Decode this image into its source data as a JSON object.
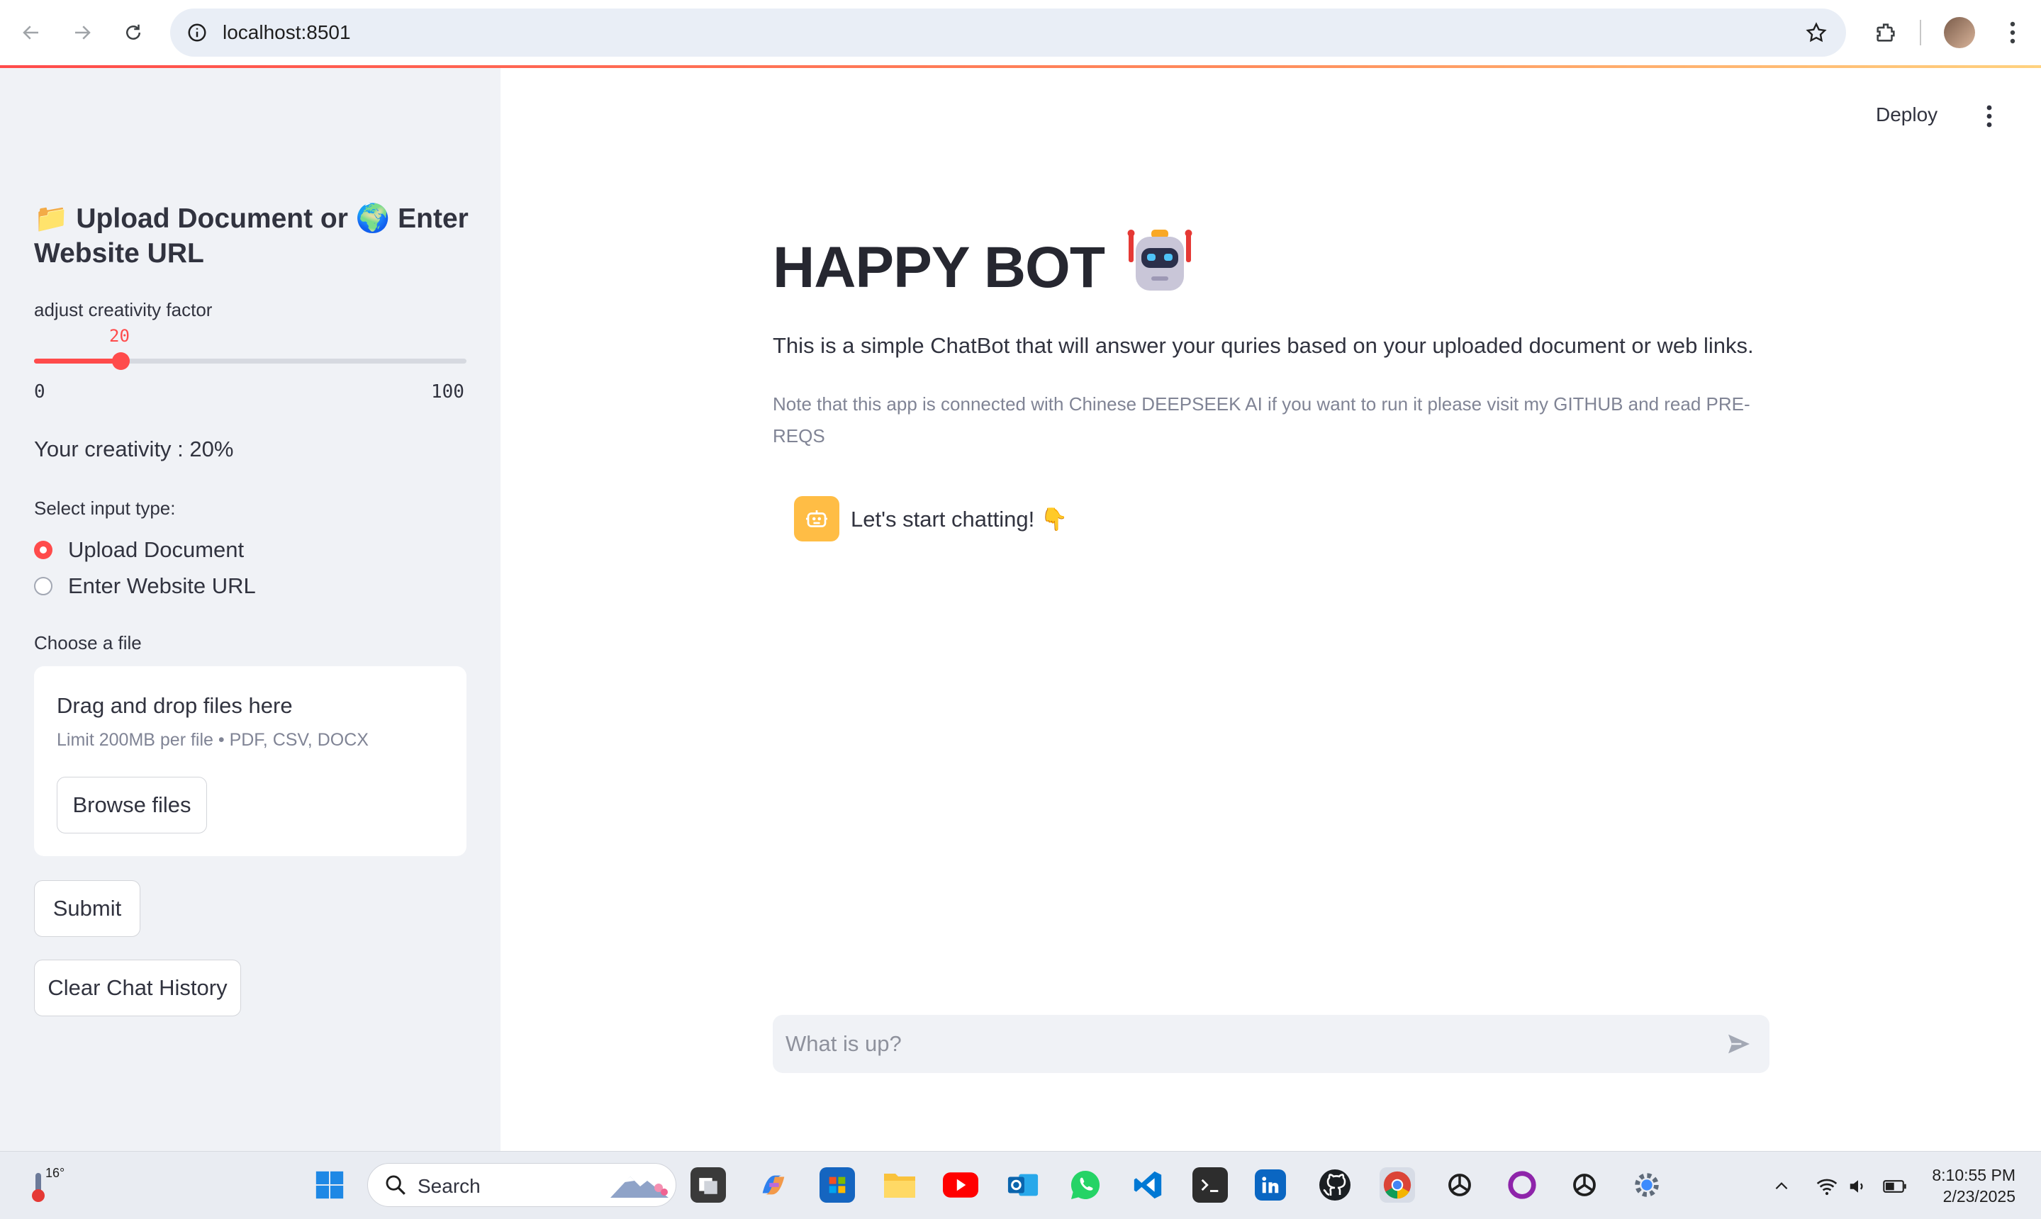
{
  "browser": {
    "url": "localhost:8501"
  },
  "sidebar": {
    "header": "📁 Upload Document or 🌍 Enter Website URL",
    "slider": {
      "label": "adjust creativity factor",
      "value": "20",
      "min": "0",
      "max": "100",
      "fraction": 0.2
    },
    "creativity_text": "Your creativity : 20%",
    "input_type": {
      "label": "Select input type:",
      "options": [
        "Upload Document",
        "Enter Website URL"
      ],
      "selected": "Upload Document"
    },
    "file": {
      "label": "Choose a file",
      "drop_title": "Drag and drop files here",
      "drop_subtitle": "Limit 200MB per file • PDF, CSV, DOCX",
      "browse_label": "Browse files"
    },
    "submit_label": "Submit",
    "clear_label": "Clear Chat History"
  },
  "main": {
    "deploy_label": "Deploy",
    "title": "HAPPY BOT",
    "description": "This is a simple ChatBot that will answer your quries based on your uploaded document or web links.",
    "note": "Note that this app is connected with Chinese DEEPSEEK AI if you want to run it please visit my GITHUB and read PRE-REQS",
    "message": "Let's start chatting! 👇",
    "chat_placeholder": "What is up?"
  },
  "taskbar": {
    "weather_temp": "16°",
    "search_label": "Search",
    "time": "8:10:55 PM",
    "date": "2/23/2025"
  },
  "colors": {
    "accent": "#ff4b4b",
    "sidebar_bg": "#f0f2f6",
    "bot_avatar": "#ffbd45"
  }
}
